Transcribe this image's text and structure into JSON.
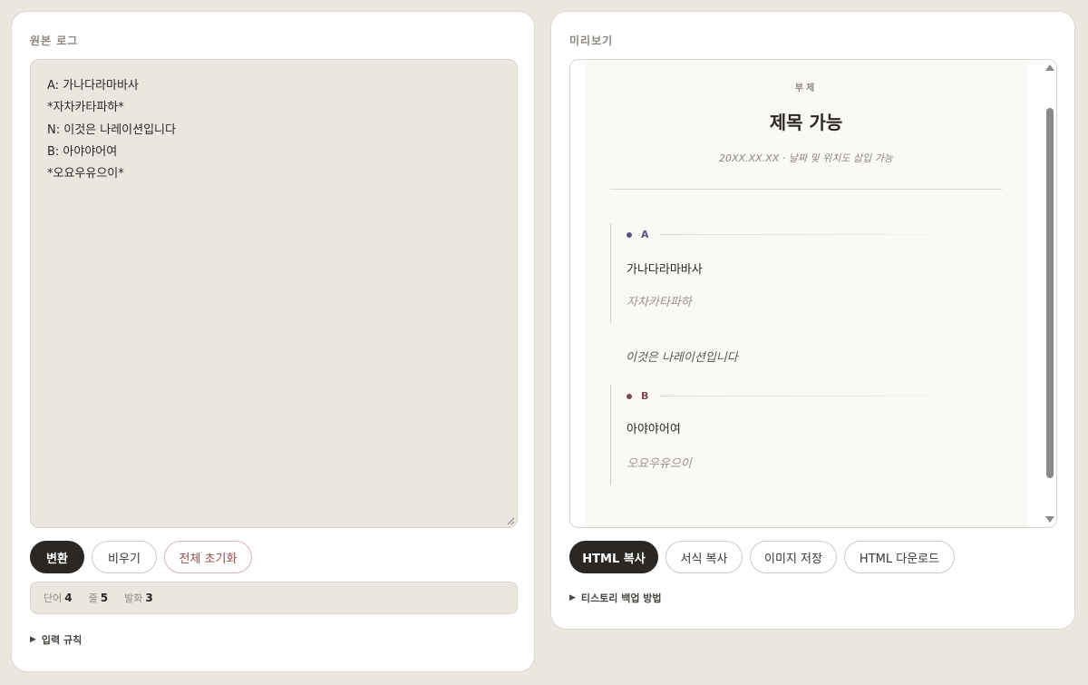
{
  "left_panel": {
    "title": "원본 로그",
    "editor_lines": [
      "A: 가나다라마바사",
      "*자차카타파하*",
      "N: 이것은 나레이션입니다",
      "B: 아야야어여",
      "*오요우유으이*"
    ],
    "buttons": {
      "convert": "변환",
      "clear": "비우기",
      "reset_all": "전체 초기화"
    },
    "stats": {
      "words_label": "단어",
      "words_value": "4",
      "lines_label": "줄",
      "lines_value": "5",
      "speakers_label": "발화",
      "speakers_value": "3"
    },
    "rules_summary": "입력 규칙"
  },
  "right_panel": {
    "title": "미리보기",
    "preview": {
      "subtitle": "부제",
      "title": "제목 가능",
      "date_line": "20XX.XX.XX · 날짜 및 위치도 삽입 가능",
      "blocks": [
        {
          "speaker": "A",
          "text": "가나다라마바사",
          "action": "자차카타파하",
          "color": "#5a5480"
        },
        {
          "speaker": "B",
          "text": "아야야어여",
          "action": "오요우유으이",
          "color": "#7a4a52"
        }
      ],
      "narration": "이것은 나레이션입니다"
    },
    "buttons": {
      "html_copy": "HTML 복사",
      "format_copy": "서식 복사",
      "save_image": "이미지 저장",
      "html_download": "HTML 다운로드"
    },
    "backup_summary": "티스토리 백업 방법"
  },
  "colors": {
    "background": "#ebe7e0",
    "primary": "#2a2724",
    "danger": "#9a4a4a"
  }
}
